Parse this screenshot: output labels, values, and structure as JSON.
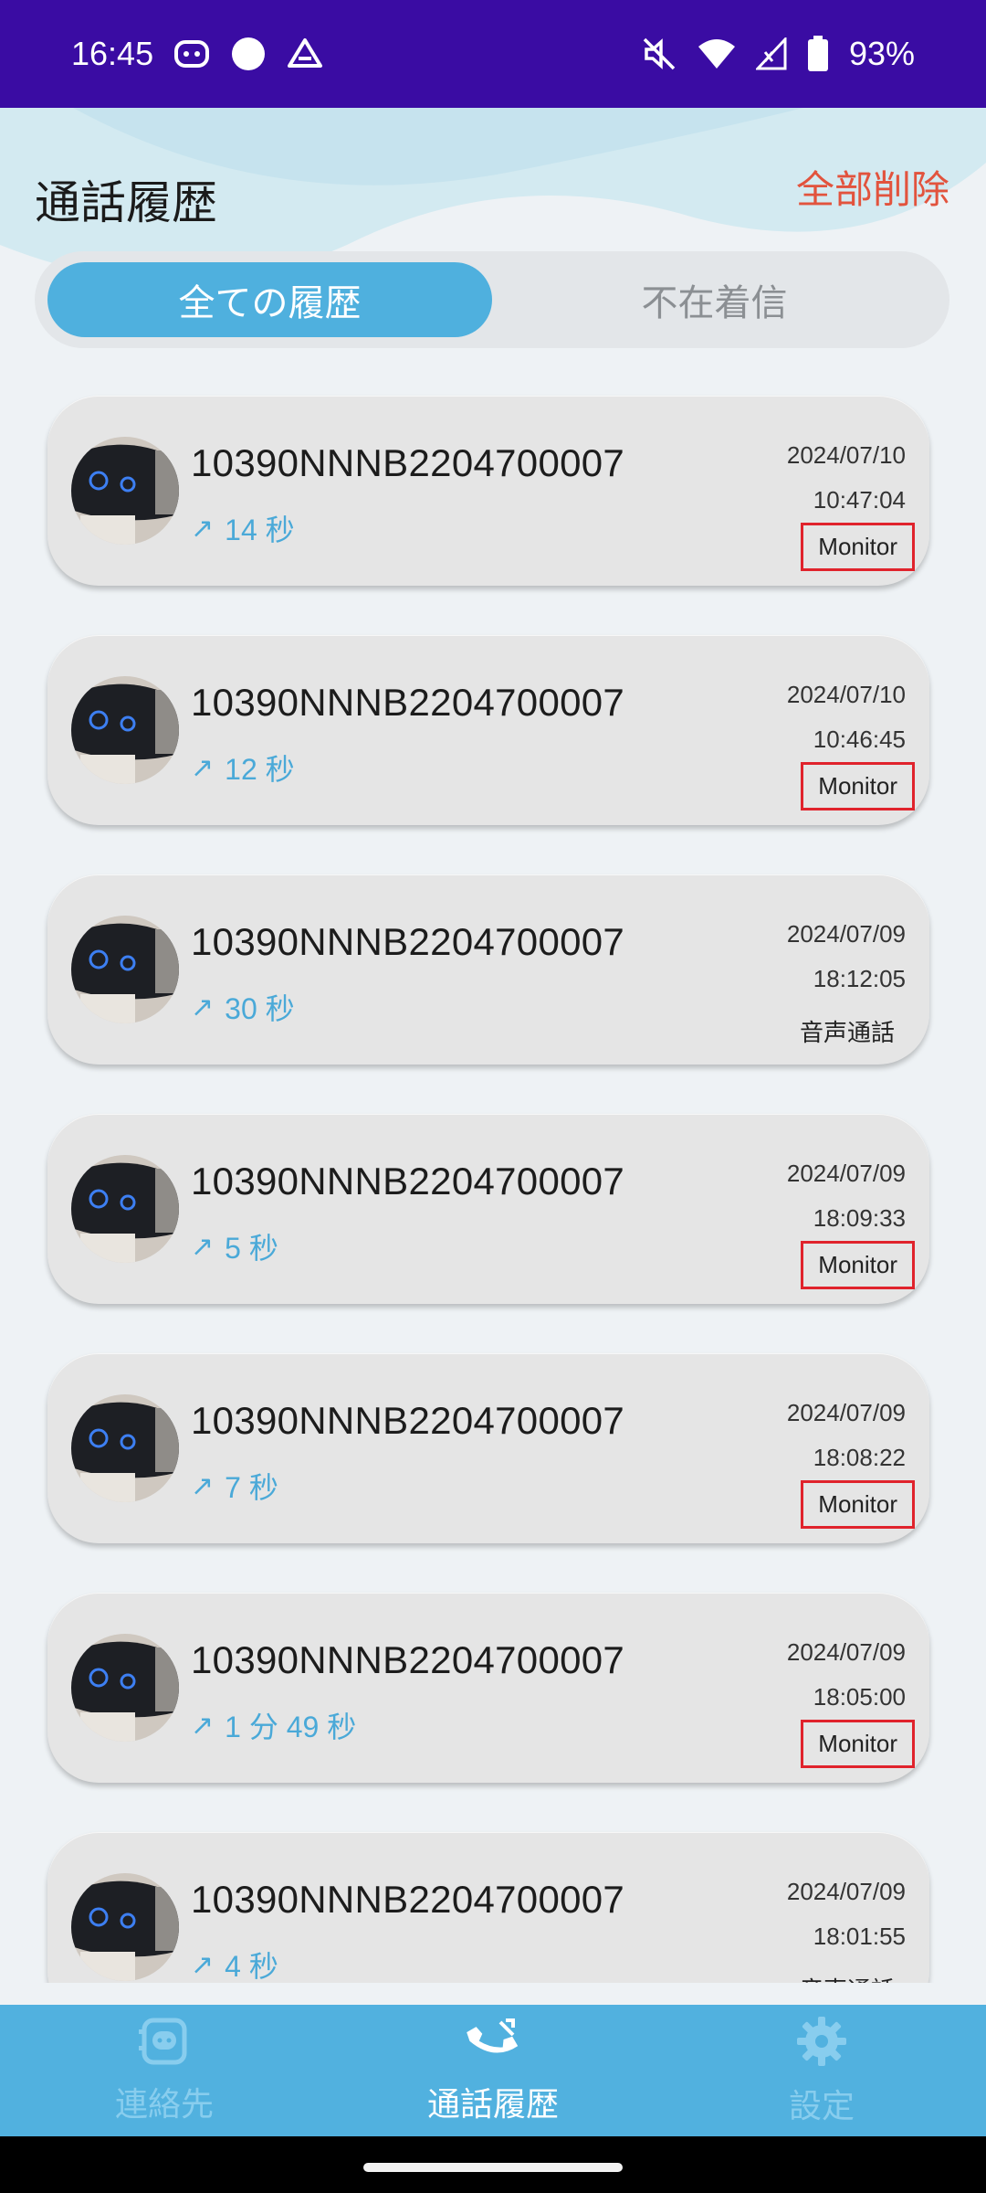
{
  "status_bar": {
    "time": "16:45",
    "battery": "93%"
  },
  "header": {
    "title": "通話履歴",
    "delete_all": "全部削除"
  },
  "tabs": [
    {
      "label": "全ての履歴",
      "active": true
    },
    {
      "label": "不在着信",
      "active": false
    }
  ],
  "calls": [
    {
      "number": "10390NNNB2204700007",
      "duration": "14 秒",
      "date": "2024/07/10",
      "time": "10:47:04",
      "type": "Monitor",
      "highlighted": true
    },
    {
      "number": "10390NNNB2204700007",
      "duration": "12 秒",
      "date": "2024/07/10",
      "time": "10:46:45",
      "type": "Monitor",
      "highlighted": true
    },
    {
      "number": "10390NNNB2204700007",
      "duration": "30 秒",
      "date": "2024/07/09",
      "time": "18:12:05",
      "type": "音声通話",
      "highlighted": false
    },
    {
      "number": "10390NNNB2204700007",
      "duration": "5 秒",
      "date": "2024/07/09",
      "time": "18:09:33",
      "type": "Monitor",
      "highlighted": true
    },
    {
      "number": "10390NNNB2204700007",
      "duration": "7 秒",
      "date": "2024/07/09",
      "time": "18:08:22",
      "type": "Monitor",
      "highlighted": true
    },
    {
      "number": "10390NNNB2204700007",
      "duration": "1 分 49 秒",
      "date": "2024/07/09",
      "time": "18:05:00",
      "type": "Monitor",
      "highlighted": true
    },
    {
      "number": "10390NNNB2204700007",
      "duration": "4 秒",
      "date": "2024/07/09",
      "time": "18:01:55",
      "type": "音声通話",
      "highlighted": false
    }
  ],
  "bottom_nav": [
    {
      "label": "連絡先",
      "icon": "contacts-robot-icon",
      "active": false
    },
    {
      "label": "通話履歴",
      "icon": "call-history-icon",
      "active": true
    },
    {
      "label": "設定",
      "icon": "gear-icon",
      "active": false
    }
  ],
  "colors": {
    "status_bar": "#3a0ca3",
    "accent": "#4fb0de",
    "delete": "#e2533d",
    "highlight_box": "#e0232c"
  }
}
